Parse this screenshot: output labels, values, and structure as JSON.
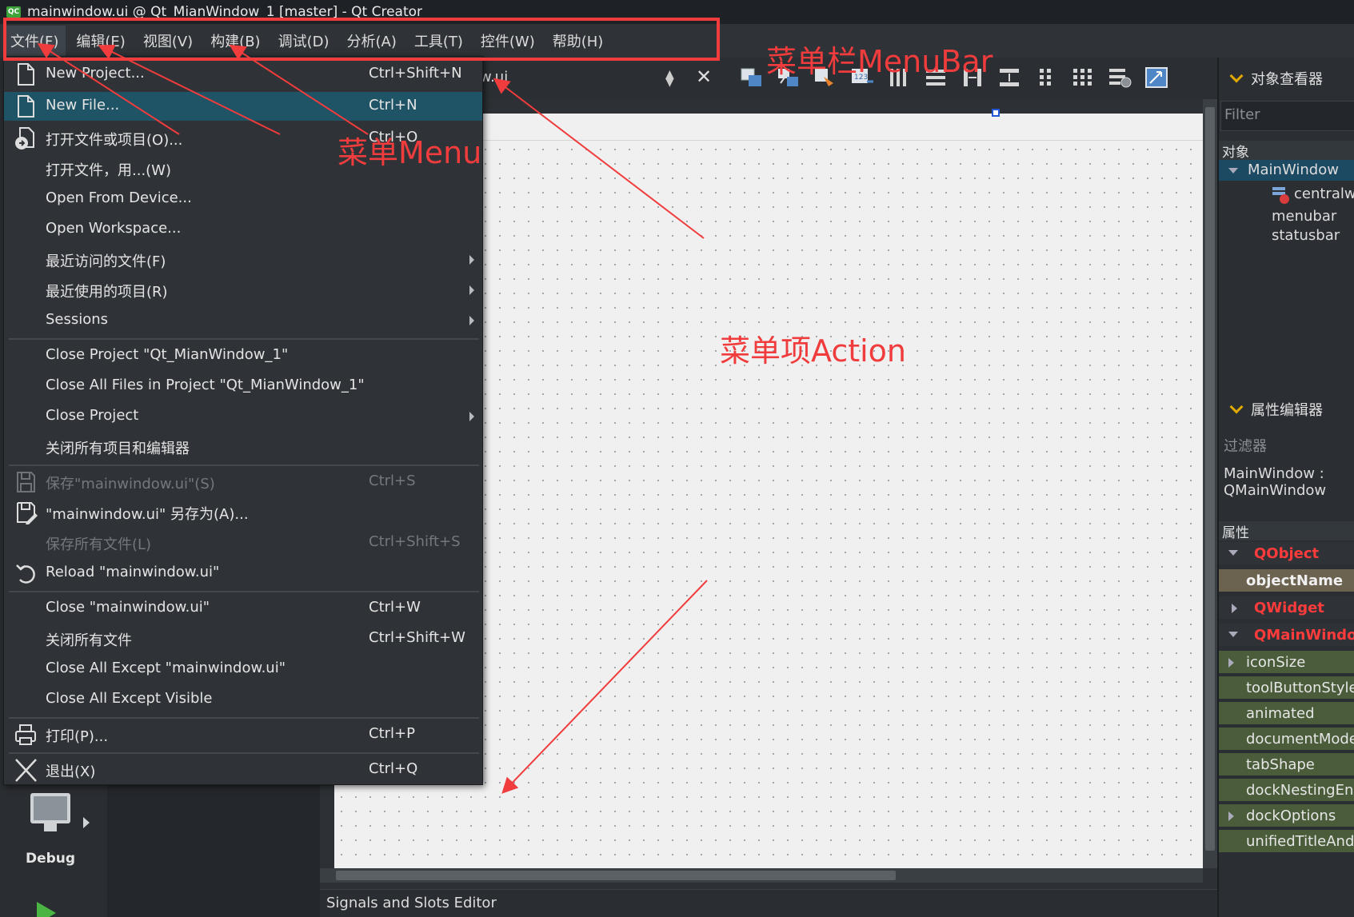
{
  "window": {
    "title": "mainwindow.ui @ Qt_MianWindow_1 [master] - Qt Creator",
    "logo": "QC"
  },
  "menubar": {
    "items": [
      "文件(F)",
      "编辑(E)",
      "视图(V)",
      "构建(B)",
      "调试(D)",
      "分析(A)",
      "工具(T)",
      "控件(W)",
      "帮助(H)"
    ]
  },
  "editor": {
    "tab_name": "w.ui"
  },
  "file_menu": {
    "items": [
      {
        "label": "New Project...",
        "shortcut": "Ctrl+Shift+N",
        "icon": "new-document-icon"
      },
      {
        "label": "New File...",
        "shortcut": "Ctrl+N",
        "icon": "new-document-icon"
      },
      {
        "label": "打开文件或项目(O)...",
        "shortcut": "Ctrl+O",
        "icon": "open-document-icon"
      },
      {
        "label": "打开文件，用...(W)",
        "shortcut": ""
      },
      {
        "label": "Open From Device...",
        "shortcut": ""
      },
      {
        "label": "Open Workspace...",
        "shortcut": ""
      },
      {
        "label": "最近访问的文件(F)",
        "shortcut": ""
      },
      {
        "label": "最近使用的项目(R)",
        "shortcut": ""
      },
      {
        "label": "Sessions",
        "shortcut": ""
      },
      {
        "label": "Close Project \"Qt_MianWindow_1\"",
        "shortcut": ""
      },
      {
        "label": "Close All Files in Project \"Qt_MianWindow_1\"",
        "shortcut": ""
      },
      {
        "label": "Close Project",
        "shortcut": ""
      },
      {
        "label": "关闭所有项目和编辑器",
        "shortcut": ""
      },
      {
        "label": "保存\"mainwindow.ui\"(S)",
        "shortcut": "Ctrl+S",
        "icon": "save-icon"
      },
      {
        "label": "\"mainwindow.ui\" 另存为(A)...",
        "shortcut": "",
        "icon": "save-as-icon"
      },
      {
        "label": "保存所有文件(L)",
        "shortcut": "Ctrl+Shift+S"
      },
      {
        "label": "Reload \"mainwindow.ui\"",
        "shortcut": "",
        "icon": "reload-icon"
      },
      {
        "label": "Close \"mainwindow.ui\"",
        "shortcut": "Ctrl+W"
      },
      {
        "label": "关闭所有文件",
        "shortcut": "Ctrl+Shift+W"
      },
      {
        "label": "Close All Except \"mainwindow.ui\"",
        "shortcut": ""
      },
      {
        "label": "Close All Except Visible",
        "shortcut": ""
      },
      {
        "label": "打印(P)...",
        "shortcut": "Ctrl+P",
        "icon": "print-icon"
      },
      {
        "label": "退出(X)",
        "shortcut": "Ctrl+Q",
        "icon": "exit-icon"
      }
    ]
  },
  "object_inspector": {
    "title": "对象查看器",
    "filter_placeholder": "Filter",
    "header": "对象",
    "tree": [
      "MainWindow",
      "centralwidget",
      "menubar",
      "statusbar"
    ]
  },
  "property_editor": {
    "title": "属性编辑器",
    "filter_placeholder": "过滤器",
    "class_label": "MainWindow : QMainWindow",
    "header": "属性",
    "rows": [
      "QObject",
      "objectName",
      "QWidget",
      "QMainWindow",
      "iconSize",
      "toolButtonStyle",
      "animated",
      "documentMode",
      "tabShape",
      "dockNestingEnabled",
      "dockOptions",
      "unifiedTitleAndToolBarOnMac"
    ]
  },
  "bottom_panel": {
    "tab": "Signals and Slots Editor"
  },
  "modebar": {
    "debug_label": "Debug"
  },
  "annotations": {
    "menubar": "菜单栏MenuBar",
    "menu": "菜单Menu",
    "action": "菜单项Action"
  },
  "colors": {
    "annotation": "#f03c3c",
    "highlight": "#1e5466",
    "category": "#ff3b3b"
  }
}
